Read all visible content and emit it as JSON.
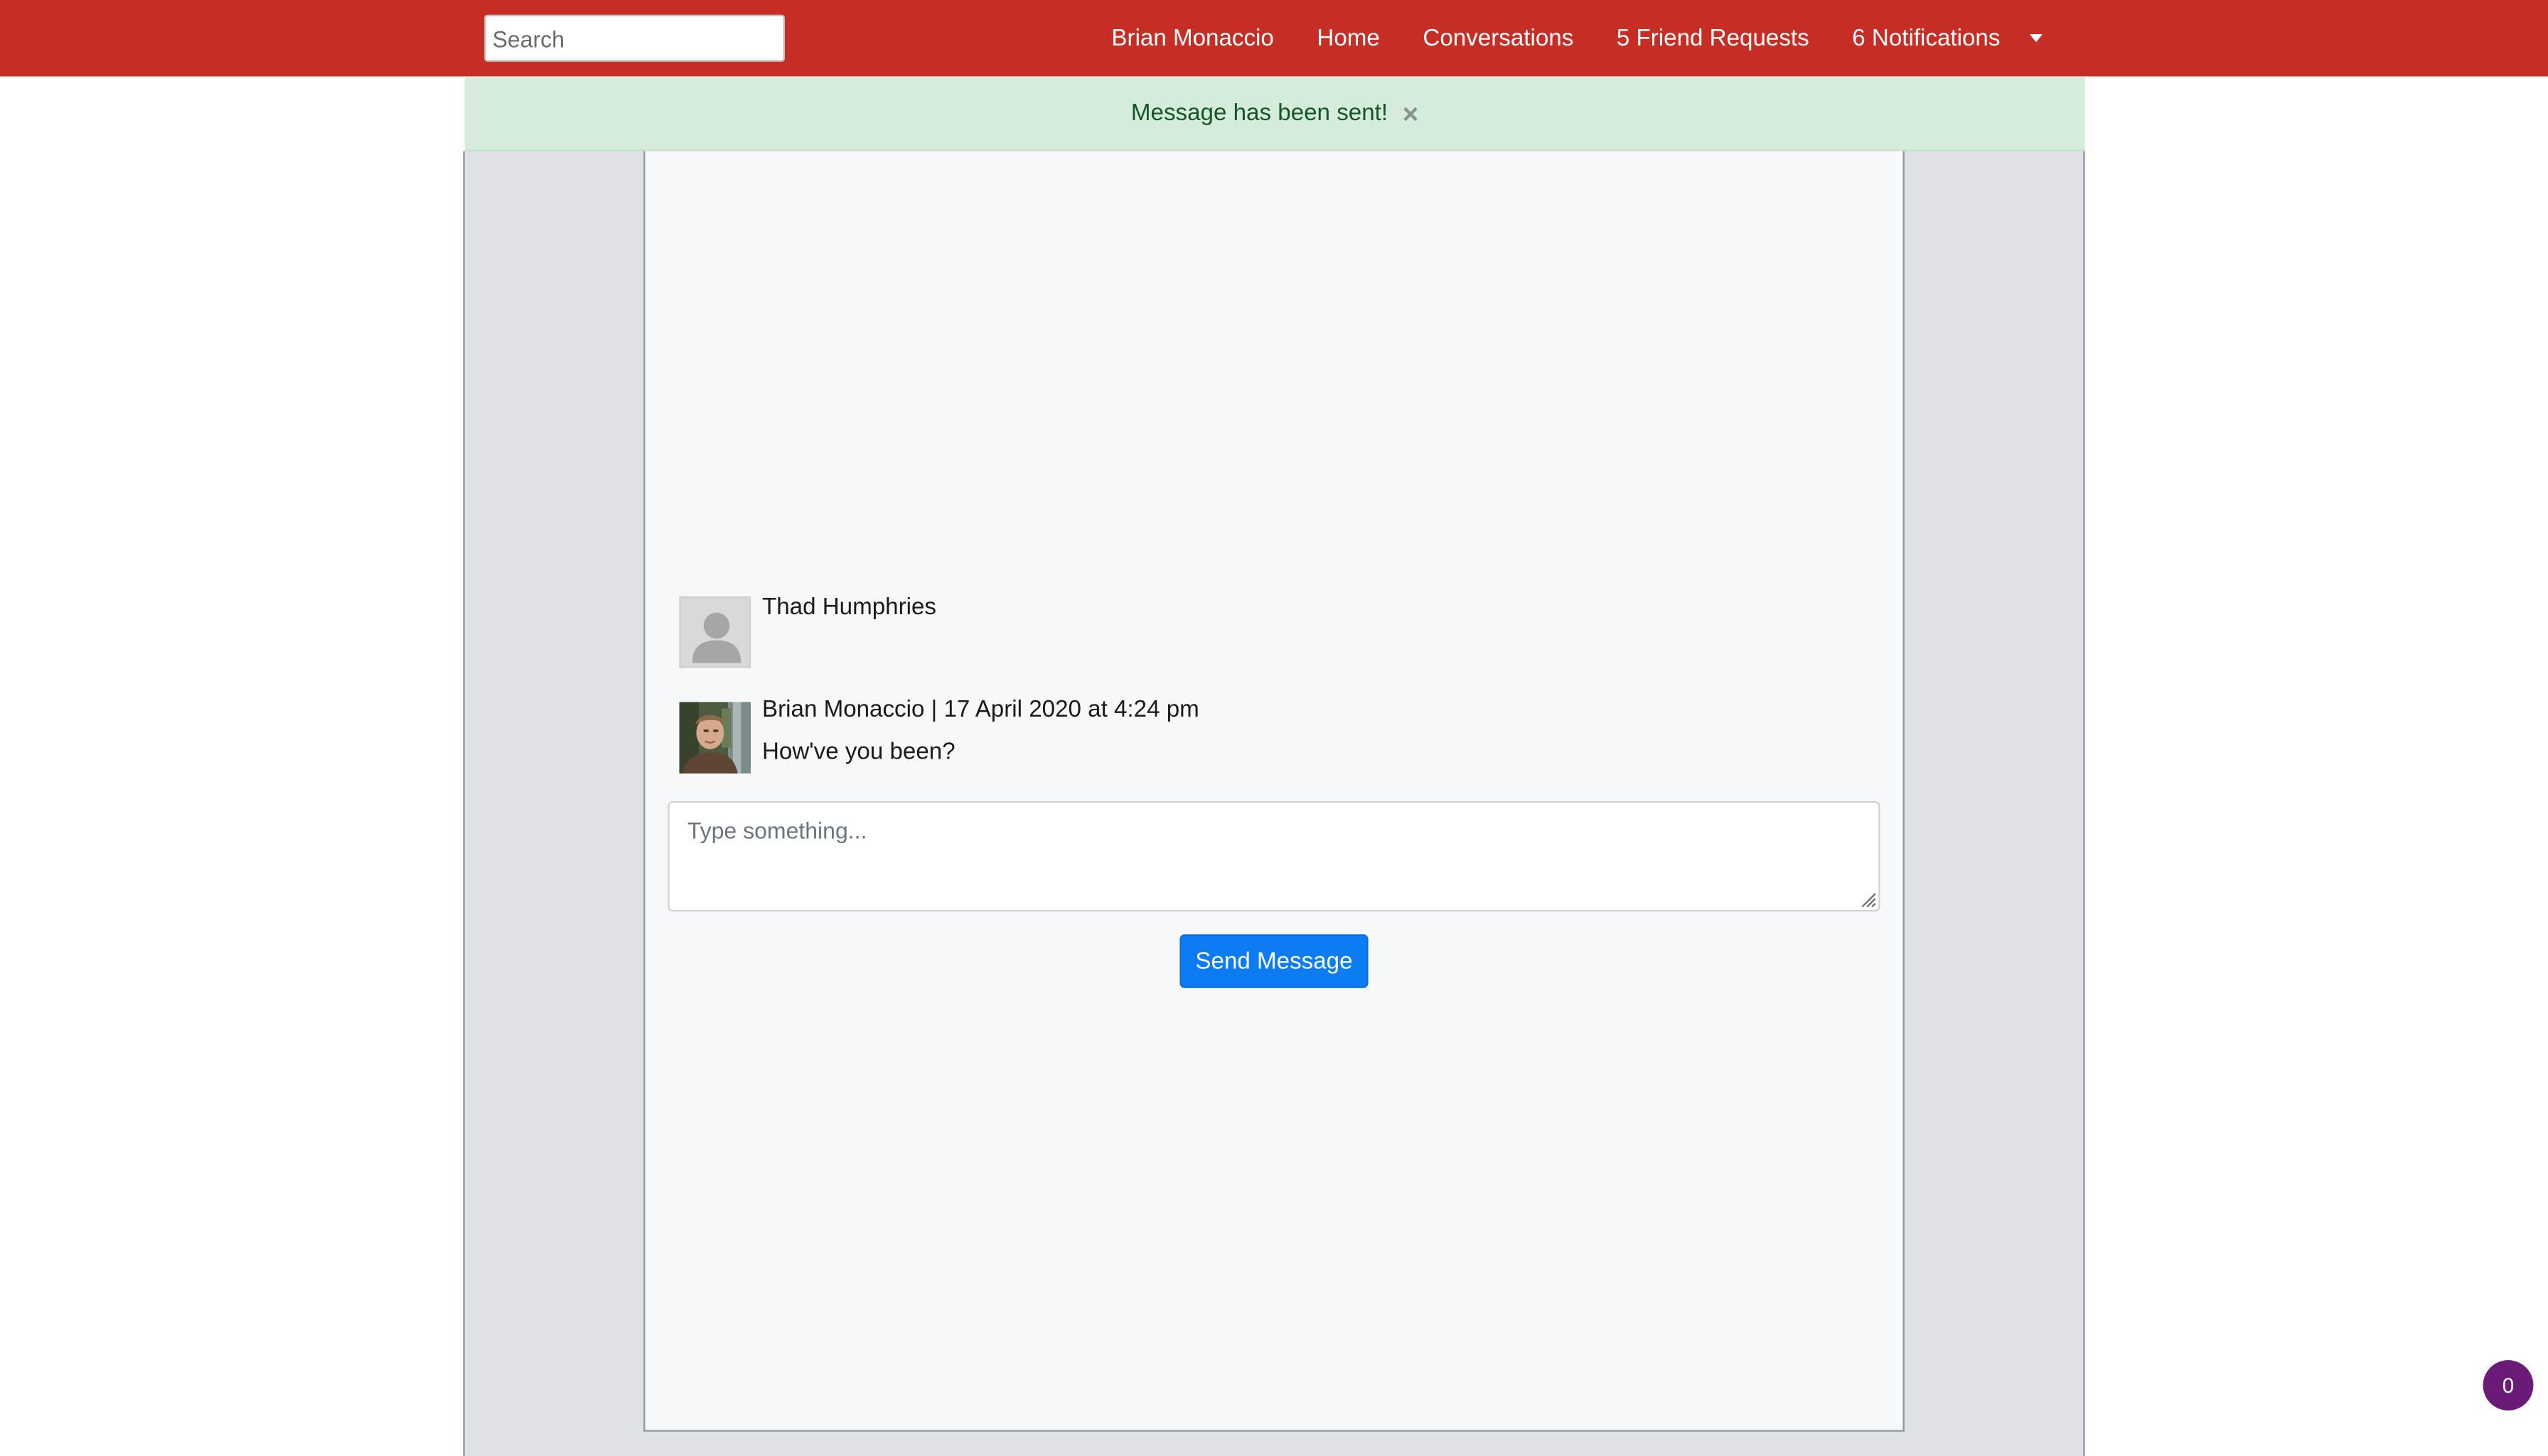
{
  "navbar": {
    "search_placeholder": "Search",
    "links": [
      {
        "label": "Brian Monaccio"
      },
      {
        "label": "Home"
      },
      {
        "label": "Conversations"
      },
      {
        "label": "5 Friend Requests"
      },
      {
        "label": "6 Notifications"
      }
    ],
    "dropdown_icon": "caret-down-icon",
    "colors": {
      "background": "#c62d24",
      "text": "#ffffff"
    }
  },
  "alert": {
    "message": "Message has been sent!",
    "close_icon": "close-icon",
    "colors": {
      "background": "#d4ecd9",
      "text": "#155724"
    }
  },
  "conversation": {
    "participant_name": "Thad Humphries",
    "participant_avatar": "default-user-avatar",
    "messages": [
      {
        "meta": "Brian Monaccio | 17 April 2020 at 4:24 pm",
        "body": "How've you been?",
        "avatar": "user-photo-avatar"
      }
    ]
  },
  "composer": {
    "placeholder": "Type something...",
    "send_label": "Send Message",
    "button_color": "#0d7cf3"
  },
  "floating_badge": {
    "count": "0",
    "color": "#6a1b78"
  }
}
